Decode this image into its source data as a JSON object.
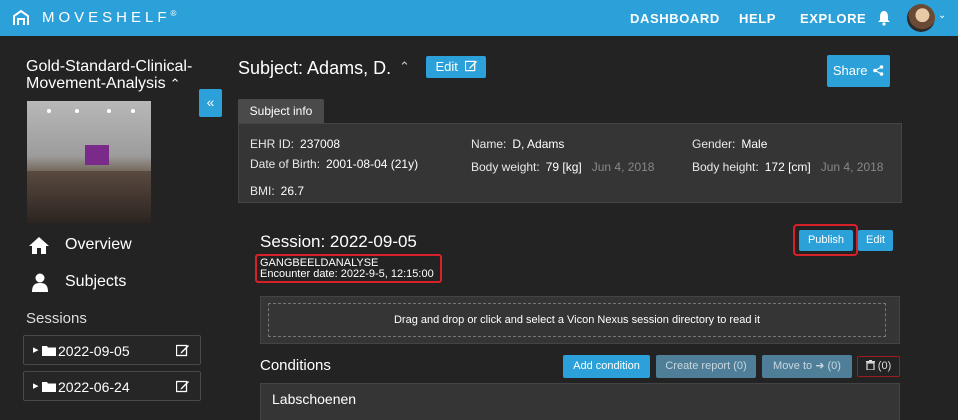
{
  "navbar": {
    "brand": "MOVESHELF",
    "reg": "®",
    "links": [
      "DASHBOARD",
      "HELP",
      "EXPLORE"
    ],
    "accent_color": "#2ca0d8"
  },
  "sidebar": {
    "project_title": "Gold-Standard-Clinical-Movement-Analysis",
    "collapse_glyph": "«",
    "nav": [
      {
        "label": "Overview",
        "icon": "home-icon"
      },
      {
        "label": "Subjects",
        "icon": "user-icon"
      }
    ],
    "sessions_heading": "Sessions",
    "sessions": [
      {
        "date": "2022-09-05"
      },
      {
        "date": "2022-06-24"
      }
    ]
  },
  "subject": {
    "title": "Subject: Adams, D.",
    "edit_label": "Edit",
    "share_label": "Share",
    "tab_label": "Subject info",
    "info": {
      "ehr_id_label": "EHR ID:",
      "ehr_id": "237008",
      "dob_label": "Date of Birth:",
      "dob": "2001-08-04 (21y)",
      "bmi_label": "BMI:",
      "bmi": "26.7",
      "name_label": "Name:",
      "name": "D, Adams",
      "weight_label": "Body weight:",
      "weight": "79 [kg]",
      "weight_date": "Jun 4, 2018",
      "gender_label": "Gender:",
      "gender": "Male",
      "height_label": "Body height:",
      "height": "172 [cm]",
      "height_date": "Jun 4, 2018"
    }
  },
  "session": {
    "title": "Session: 2022-09-05",
    "encounter_name": "GANGBEELDANALYSE",
    "encounter_date": "Encounter date: 2022-9-5, 12:15:00",
    "publish_label": "Publish",
    "edit_label": "Edit",
    "dropzone_text": "Drag and drop or click and select a Vicon Nexus session directory to read it",
    "highlight_color": "#d6212a"
  },
  "conditions": {
    "heading": "Conditions",
    "add_label": "Add condition",
    "report_label": "Create report (0)",
    "move_label": "Move to",
    "move_count": "(0)",
    "delete_count": "(0)",
    "items": [
      {
        "name": "Labschoenen"
      }
    ]
  }
}
